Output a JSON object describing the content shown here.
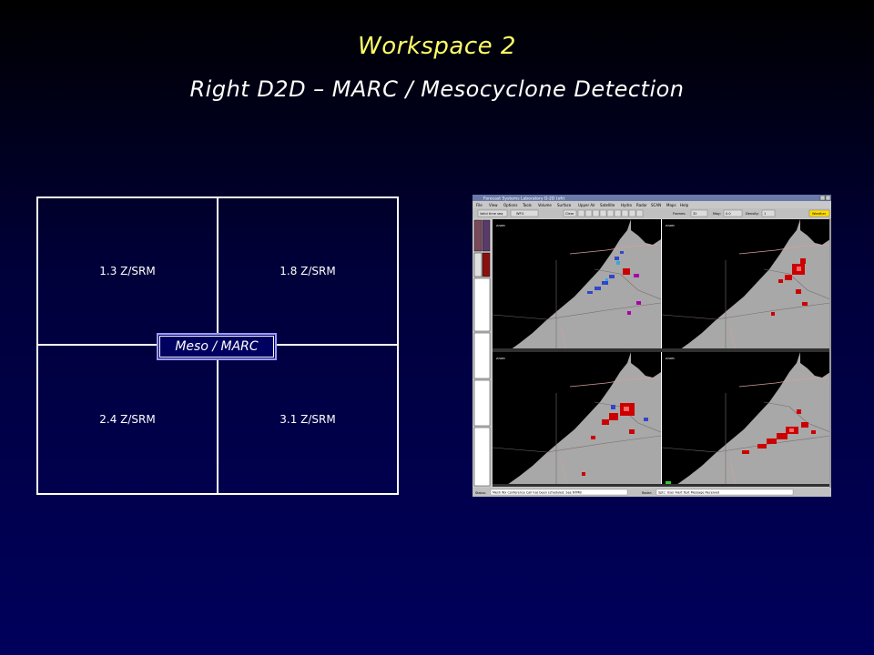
{
  "slide": {
    "title": "Workspace 2",
    "subtitle": "Right D2D – MARC / Mesocyclone Detection"
  },
  "layout_grid": {
    "panels": [
      "1.3 Z/SRM",
      "1.8 Z/SRM",
      "2.4 Z/SRM",
      "3.1 Z/SRM"
    ],
    "center_label": "Meso / MARC"
  },
  "screenshot": {
    "window_title": "Forecast Systems Laboratory D-2D (ofr)",
    "menu": [
      "File",
      "View",
      "Options",
      "Tools",
      "Volume",
      "Surface",
      "Upper Air",
      "Satellite",
      "Hydro",
      "Radar",
      "SCAN",
      "Maps",
      "Help"
    ],
    "toolbar": {
      "valid_time_label": "Valid time seq",
      "wfo_label": "WFO",
      "clear_label": "Clear",
      "frames_label": "Frames:",
      "frames_value": "32",
      "mag_label": "Mag:",
      "mag_value": "0.0",
      "density_label": "Density:",
      "density_value": "1",
      "weather_label": "Weather"
    },
    "status_left": "Status:",
    "status_msg1": "Mesh Wx Conference Call has been scheduled. See NTMB",
    "radar_label": "Radar:",
    "status_msg2": "Sptc: User Alert Text Message Received",
    "colors": {
      "ground": "#a8a8a8",
      "no_data": "#000000",
      "reflectivity_high": "#cc0000",
      "velocity_in": "#3344cc",
      "meso_marker": "#aa00aa"
    }
  }
}
